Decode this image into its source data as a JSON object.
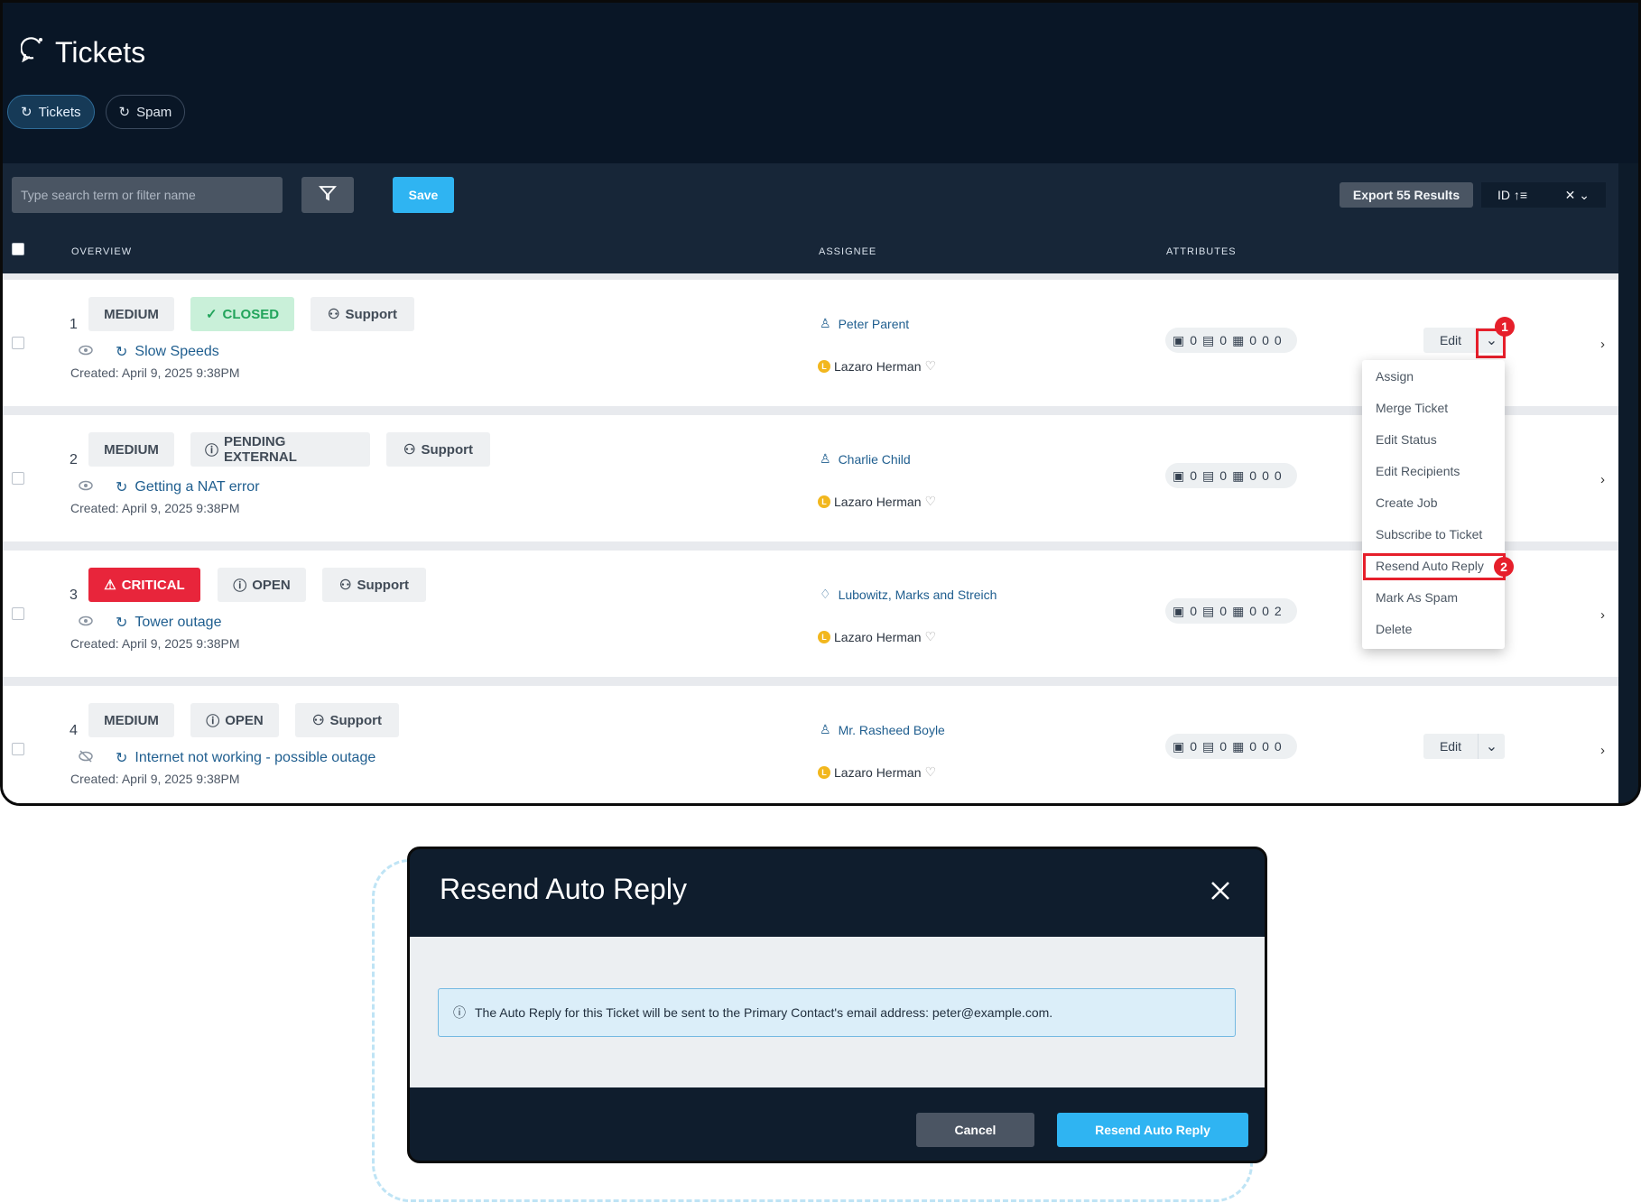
{
  "header": {
    "title": "Tickets",
    "tabs": [
      {
        "label": "Tickets"
      },
      {
        "label": "Spam"
      }
    ]
  },
  "toolbar": {
    "search_placeholder": "Type search term or filter name",
    "save_label": "Save",
    "export_label": "Export 55 Results",
    "sort_label": "ID"
  },
  "table": {
    "headers": [
      "OVERVIEW",
      "ASSIGNEE",
      "ATTRIBUTES"
    ]
  },
  "rows": [
    {
      "number": "1",
      "priority": "MEDIUM",
      "status": "CLOSED",
      "team": "Support",
      "subject": "Slow Speeds",
      "created": "Created: April 9, 2025 9:38PM",
      "assignee": "Peter Parent",
      "assigned_to": "Lazaro Herman",
      "attrs": [
        "0",
        "0",
        "0",
        "0",
        "0"
      ]
    },
    {
      "number": "2",
      "priority": "MEDIUM",
      "status": "PENDING EXTERNAL",
      "team": "Support",
      "subject": "Getting a NAT error",
      "created": "Created: April 9, 2025 9:38PM",
      "assignee": "Charlie Child",
      "assigned_to": "Lazaro Herman",
      "attrs": [
        "0",
        "0",
        "0",
        "0",
        "0"
      ]
    },
    {
      "number": "3",
      "priority": "CRITICAL",
      "status": "OPEN",
      "team": "Support",
      "subject": "Tower outage",
      "created": "Created: April 9, 2025 9:38PM",
      "assignee": "Lubowitz, Marks and Streich",
      "assigned_to": "Lazaro Herman",
      "attrs": [
        "0",
        "0",
        "0",
        "0",
        "2"
      ]
    },
    {
      "number": "4",
      "priority": "MEDIUM",
      "status": "OPEN",
      "team": "Support",
      "subject": "Internet not working - possible outage",
      "created": "Created: April 9, 2025 9:38PM",
      "assignee": "Mr. Rasheed Boyle",
      "assigned_to": "Lazaro Herman",
      "attrs": [
        "0",
        "0",
        "0",
        "0",
        "0"
      ]
    }
  ],
  "actions": {
    "edit_label": "Edit"
  },
  "menu": {
    "items": [
      "Assign",
      "Merge Ticket",
      "Edit Status",
      "Edit Recipients",
      "Create Job",
      "Subscribe to Ticket",
      "Resend Auto Reply",
      "Mark As Spam",
      "Delete"
    ]
  },
  "annotations": {
    "step1": "1",
    "step2": "2"
  },
  "modal": {
    "title": "Resend Auto Reply",
    "message": "The Auto Reply for this Ticket will be sent to the Primary Contact's email address: peter@example.com.",
    "cancel_label": "Cancel",
    "confirm_label": "Resend Auto Reply"
  },
  "colors": {
    "dark_navy": "#0d1b2a",
    "accent_blue": "#2fb4f2",
    "link_blue": "#1f5e8f",
    "critical_red": "#e8253b",
    "closed_green": "#22a45b",
    "highlight_red": "#e61f2b",
    "alert_blue": "#dbeef9"
  },
  "icons": [
    "ticket-icon",
    "spam-icon",
    "filter-icon",
    "sort-icon",
    "close-icon",
    "chevron-down-icon",
    "check-icon",
    "info-icon",
    "warning-icon",
    "team-icon",
    "eye-icon",
    "eye-off-icon",
    "person-icon",
    "company-icon",
    "document-icon",
    "briefcase-icon",
    "chevron-right-icon"
  ]
}
